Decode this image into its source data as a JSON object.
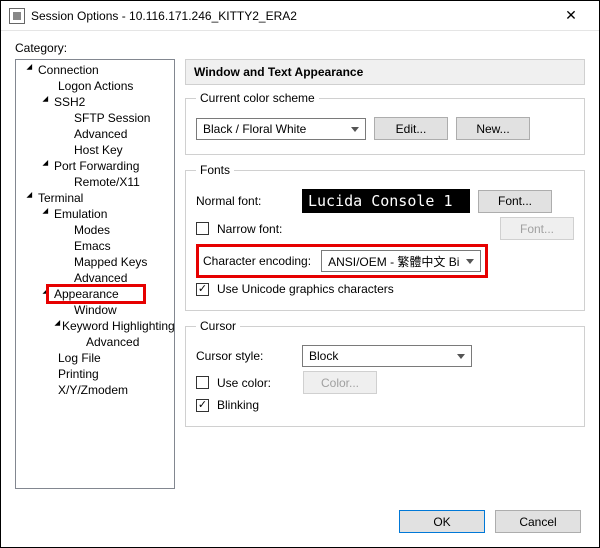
{
  "titlebar": {
    "title": "Session Options - 10.116.171.246_KITTY2_ERA2"
  },
  "category_label": "Category:",
  "tree": {
    "connection": "Connection",
    "logon_actions": "Logon Actions",
    "ssh2": "SSH2",
    "sftp_session": "SFTP Session",
    "advanced1": "Advanced",
    "host_key": "Host Key",
    "port_forwarding": "Port Forwarding",
    "remote_x11": "Remote/X11",
    "terminal": "Terminal",
    "emulation": "Emulation",
    "modes": "Modes",
    "emacs": "Emacs",
    "mapped_keys": "Mapped Keys",
    "advanced2": "Advanced",
    "appearance": "Appearance",
    "window": "Window",
    "keyword_hl": "Keyword Highlighting",
    "advanced3": "Advanced",
    "log_file": "Log File",
    "printing": "Printing",
    "xyzmodem": "X/Y/Zmodem"
  },
  "panel": {
    "header": "Window and Text Appearance",
    "scheme_group": "Current color scheme",
    "scheme_value": "Black / Floral White",
    "edit_btn": "Edit...",
    "new_btn": "New...",
    "fonts_group": "Fonts",
    "normal_font_label": "Normal font:",
    "normal_font_preview": "Lucida Console 1",
    "font_btn": "Font...",
    "narrow_font_label": "Narrow font:",
    "font_btn_disabled": "Font...",
    "encoding_label": "Character encoding:",
    "encoding_value": "ANSI/OEM - 繁體中文 Bi",
    "unicode_label": "Use Unicode graphics characters",
    "cursor_group": "Cursor",
    "cursor_style_label": "Cursor style:",
    "cursor_style_value": "Block",
    "use_color_label": "Use color:",
    "color_btn": "Color...",
    "blinking_label": "Blinking"
  },
  "footer": {
    "ok": "OK",
    "cancel": "Cancel"
  }
}
